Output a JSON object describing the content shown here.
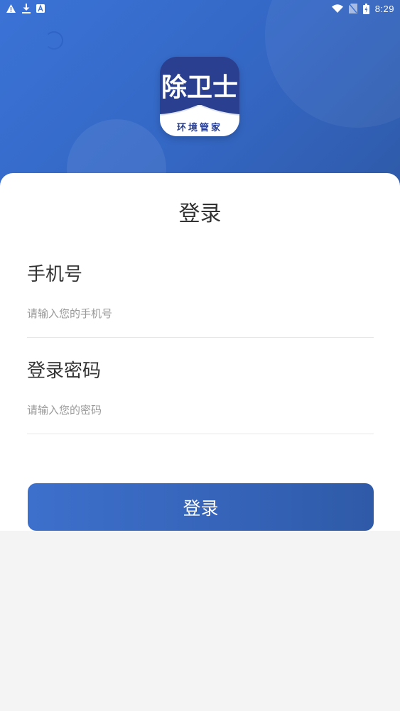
{
  "status_bar": {
    "time": "8:29",
    "left_icons": [
      "warning-icon",
      "download-icon",
      "a-icon"
    ],
    "right_icons": [
      "wifi-icon",
      "no-sim-icon",
      "battery-icon"
    ]
  },
  "app_icon": {
    "brand": "除卫士",
    "subtitle": "环境管家"
  },
  "login": {
    "title": "登录",
    "phone_label": "手机号",
    "phone_placeholder": "请输入您的手机号",
    "phone_value": "",
    "password_label": "登录密码",
    "password_placeholder": "请输入您的密码",
    "password_value": "",
    "button_label": "登录"
  },
  "colors": {
    "primary": "#3467c4",
    "brand_dark": "#2a3f8f",
    "background": "#f4f4f4"
  }
}
